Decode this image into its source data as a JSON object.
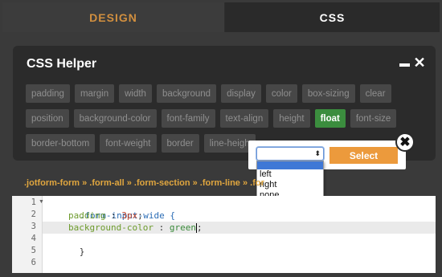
{
  "tabs": [
    {
      "label": "DESIGN"
    },
    {
      "label": "CSS"
    }
  ],
  "helper": {
    "title": "CSS Helper",
    "minimize_glyph": "—",
    "close_glyph": "✕",
    "rows": [
      [
        "padding",
        "margin",
        "width",
        "background",
        "display",
        "color",
        "box-sizing",
        "clear"
      ],
      [
        "position",
        "background-color",
        "font-family",
        "text-align",
        "height",
        "float",
        "font-size"
      ],
      [
        "border-bottom",
        "font-weight",
        "border",
        "line-heigh"
      ]
    ],
    "active": "float"
  },
  "popup": {
    "selected_value": "",
    "select_arrows": "⬍",
    "button_label": "Select",
    "close_glyph": "✖",
    "options": [
      "left",
      "right",
      "none"
    ]
  },
  "breadcrumb": {
    "text": ".jotform-form » .form-all » .form-section » .form-line » .for"
  },
  "editor": {
    "line_numbers": [
      "1",
      "2",
      "3",
      "4",
      "5",
      "6"
    ],
    "fold_marker": "▼",
    "lines": {
      "selector": ".form-input-wide {",
      "l2_prop": "padding",
      "l2_sep": " : ",
      "l2_val": "3px",
      "l2_end": ";",
      "l3_prop": "background-color",
      "l3_sep": " : ",
      "l3_val": "green",
      "l3_end": ";",
      "close": "}"
    }
  },
  "colors": {
    "accent_orange": "#ec9a3c",
    "active_green": "#3b8d3e",
    "breadcrumb_gold": "#e0a63f"
  }
}
